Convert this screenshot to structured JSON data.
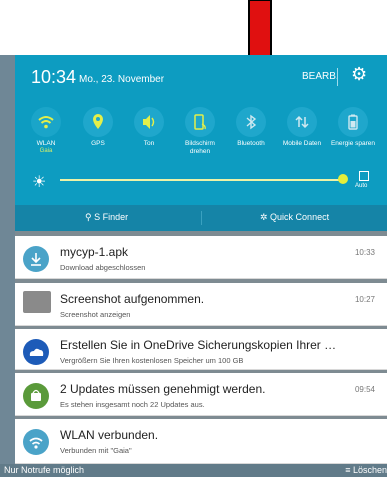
{
  "status": {
    "time": "10:34",
    "date": "Mo., 23. November",
    "edit_label": "BEARB."
  },
  "toggles": [
    {
      "label": "WLAN",
      "sub": "Gaia",
      "icon": "wifi-icon"
    },
    {
      "label": "GPS",
      "sub": "",
      "icon": "location-icon"
    },
    {
      "label": "Ton",
      "sub": "",
      "icon": "sound-icon"
    },
    {
      "label": "Bildschirm drehen",
      "sub": "",
      "icon": "rotate-icon"
    },
    {
      "label": "Bluetooth",
      "sub": "",
      "icon": "bluetooth-icon"
    },
    {
      "label": "Mobile Daten",
      "sub": "",
      "icon": "mobile-data-icon"
    },
    {
      "label": "Energie sparen",
      "sub": "",
      "icon": "battery-icon"
    }
  ],
  "brightness": {
    "level": 0.98,
    "auto_label": "Auto"
  },
  "actions": {
    "finder": "S Finder",
    "quick_connect": "Quick Connect"
  },
  "notifications": [
    {
      "title": "mycyp-1.apk",
      "sub": "Download abgeschlossen",
      "time": "10:33",
      "icon": "download-icon",
      "color": "#4aa3c8"
    },
    {
      "title": "Screenshot aufgenommen.",
      "sub": "Screenshot anzeigen",
      "time": "10:27",
      "icon": "screenshot-thumbnail-icon",
      "color": "#7a7a7a"
    },
    {
      "title": "Erstellen Sie in OneDrive Sicherungskopien Ihrer Fotos und V..",
      "sub": "Vergrößern Sie Ihren kostenlosen Speicher um 100 GB",
      "time": "",
      "icon": "onedrive-icon",
      "color": "#1d5bb8"
    },
    {
      "title": "2 Updates müssen genehmigt werden.",
      "sub": "Es stehen insgesamt noch 22 Updates aus.",
      "time": "09:54",
      "icon": "updates-icon",
      "color": "#5a9a3a"
    },
    {
      "title": "WLAN verbunden.",
      "sub": "Verbunden mit \"Gaia\"",
      "time": "",
      "icon": "wifi-icon",
      "color": "#4aa3c8"
    }
  ],
  "footer": {
    "left": "Nur Notrufe möglich",
    "right": "Löschen"
  },
  "colors": {
    "accent": "#0d9cc1",
    "arrow": "#e01010"
  }
}
